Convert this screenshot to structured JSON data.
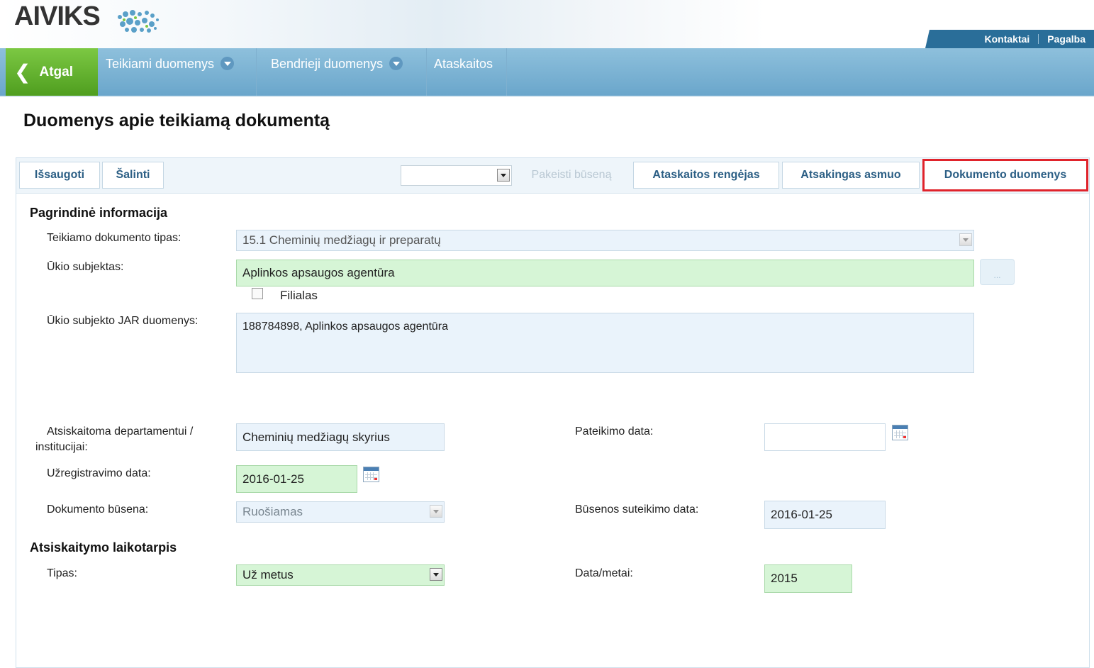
{
  "header": {
    "logo_text": "AIVIKS",
    "links": [
      "Kontaktai",
      "Pagalba"
    ]
  },
  "nav": {
    "back_label": "Atgal",
    "items": [
      {
        "label": "Teikiami duomenys",
        "has_dropdown": true
      },
      {
        "label": "Bendrieji duomenys",
        "has_dropdown": true
      },
      {
        "label": "Ataskaitos",
        "has_dropdown": false
      }
    ]
  },
  "page_title": "Duomenys apie teikiamą dokumentą",
  "toolbar": {
    "save_label": "Išsaugoti",
    "delete_label": "Šalinti",
    "status_select_value": "",
    "change_status_label": "Pakeisti būseną",
    "tabs": [
      "Ataskaitos rengėjas",
      "Atsakingas asmuo",
      "Dokumento duomenys"
    ],
    "active_tab": "Dokumento duomenys"
  },
  "main_info": {
    "heading": "Pagrindinė informacija",
    "doc_type_label": "Teikiamo dokumento tipas:",
    "doc_type_value": "15.1 Cheminių medžiagų ir preparatų",
    "subject_label": "Ūkio subjektas:",
    "subject_value": "Aplinkos apsaugos agentūra",
    "subject_btn_label": "...",
    "branch_label": "Filialas",
    "branch_checked": false,
    "jar_label": "Ūkio subjekto JAR duomenys:",
    "jar_value": "188784898, Aplinkos apsaugos agentūra",
    "department_label": "Atsiskaitoma departamentui / institucijai:",
    "department_value": "Cheminių medžiagų skyrius",
    "submit_date_label": "Pateikimo data:",
    "submit_date_value": "",
    "reg_date_label": "Užregistravimo data:",
    "reg_date_value": "2016-01-25",
    "status_label": "Dokumento būsena:",
    "status_value": "Ruošiamas",
    "status_date_label": "Būsenos suteikimo data:",
    "status_date_value": "2016-01-25"
  },
  "period": {
    "heading": "Atsiskaitymo laikotarpis",
    "type_label": "Tipas:",
    "type_value": "Už metus",
    "year_label": "Data/metai:",
    "year_value": "2015"
  },
  "colors": {
    "nav_blue": "#6aa6cb",
    "back_green": "#4f9e1f",
    "required_field": "#d6f5d6",
    "readonly_field": "#eaf3fb",
    "active_tab_border": "#e0232b"
  }
}
